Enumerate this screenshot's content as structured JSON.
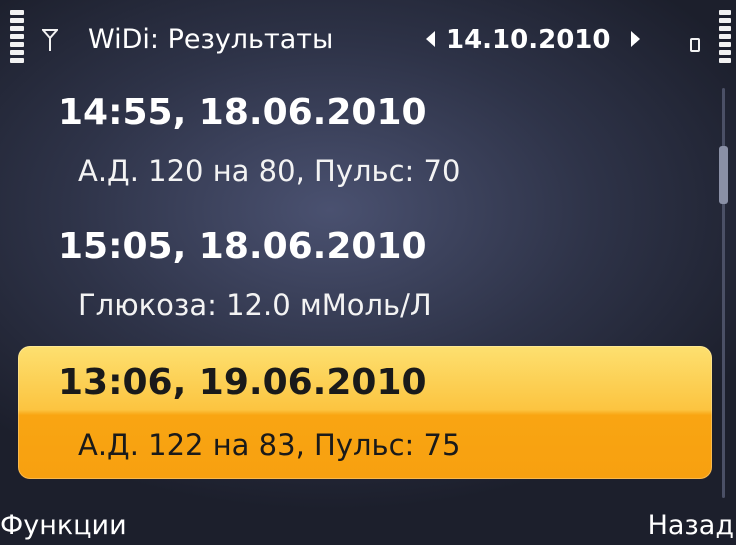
{
  "status_bar": {
    "title": "WiDi: Результаты",
    "date": "14.10.2010",
    "icons": [
      "signal-strength-icon",
      "antenna-icon",
      "arrow-left-icon",
      "arrow-right-icon",
      "lock-icon",
      "battery-icon"
    ]
  },
  "results": [
    {
      "time": "14:55, 18.06.2010",
      "detail": "А.Д. 120 на 80, Пульс: 70",
      "selected": false
    },
    {
      "time": "15:05, 18.06.2010",
      "detail": "Глюкоза: 12.0 мМоль/Л",
      "selected": false
    },
    {
      "time": "13:06, 19.06.2010",
      "detail": "А.Д. 122 на 83, Пульс: 75",
      "selected": true
    }
  ],
  "softkeys": {
    "left": "Функции",
    "right": "Назад"
  },
  "colors": {
    "background": "#2e3348",
    "highlight_top": "#fde070",
    "highlight_bottom": "#f7a010",
    "text": "#ffffff",
    "selected_text": "#1a1a1a"
  }
}
